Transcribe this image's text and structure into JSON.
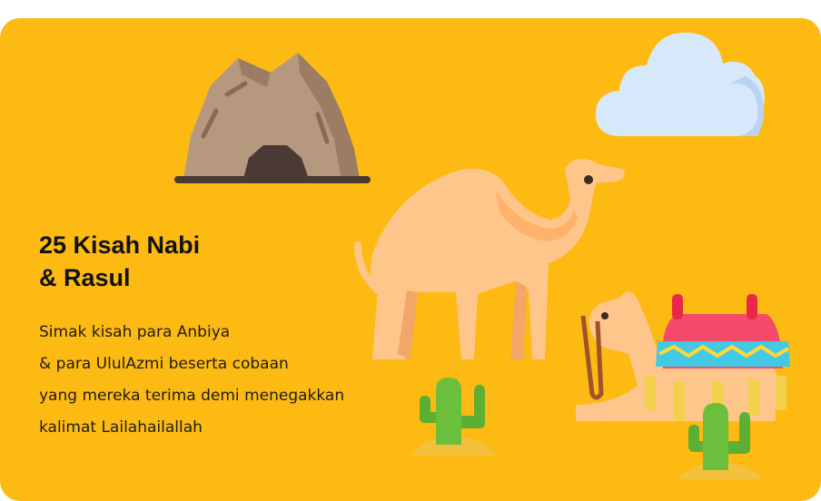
{
  "card": {
    "title_lines": [
      "25 Kisah Nabi",
      "& Rasul"
    ],
    "description_lines": [
      "Simak kisah para Anbiya",
      "& para UlulAzmi beserta cobaan",
      "yang mereka terima demi menegakkan",
      "kalimat Lailahailallah"
    ],
    "background_color": "#FDBA12"
  },
  "illustrations": [
    "cave-icon",
    "cloud-icon",
    "standing-camel-icon",
    "sitting-camel-icon",
    "cactus-icon",
    "cactus-icon"
  ]
}
